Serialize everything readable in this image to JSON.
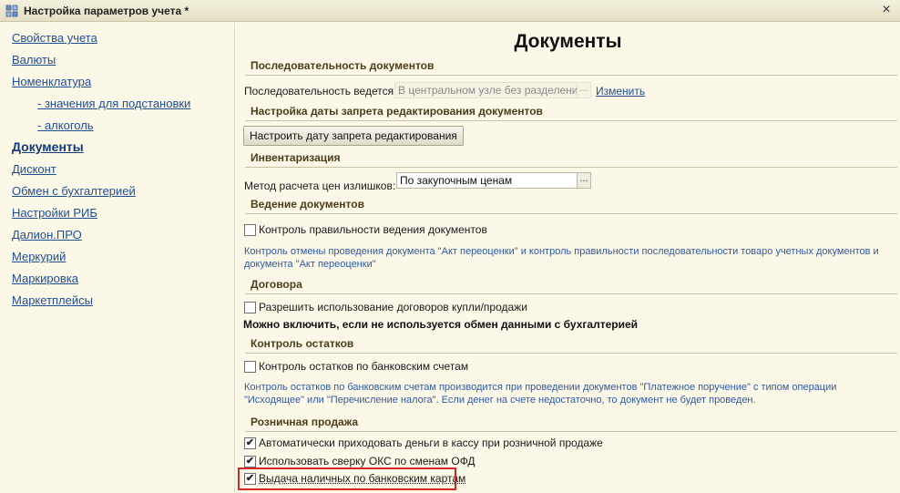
{
  "window": {
    "title": "Настройка параметров учета *",
    "close_icon": "close-icon"
  },
  "sidebar": {
    "items": [
      {
        "label": "Свойства учета"
      },
      {
        "label": "Валюты"
      },
      {
        "label": "Номенклатура"
      },
      {
        "label": "- значения для подстановки"
      },
      {
        "label": "- алкоголь"
      },
      {
        "label": "Документы",
        "active": true
      },
      {
        "label": "Дисконт"
      },
      {
        "label": "Обмен с бухгалтерией"
      },
      {
        "label": "Настройки РИБ"
      },
      {
        "label": "Далион.ПРО"
      },
      {
        "label": "Меркурий"
      },
      {
        "label": "Маркировка"
      },
      {
        "label": "Маркетплейсы"
      }
    ]
  },
  "main": {
    "title": "Документы",
    "sequence": {
      "header": "Последовательность документов",
      "label": "Последовательность ведется:",
      "value": "В центральном узле без разделения г",
      "dots": "...",
      "change_link": "Изменить"
    },
    "lock_date": {
      "header": "Настройка даты запрета редактирования документов",
      "button": "Настроить дату запрета редактирования"
    },
    "inventory": {
      "header": "Инвентаризация",
      "label": "Метод расчета цен излишков:",
      "value": "По закупочным ценам",
      "dots": "..."
    },
    "doc_keeping": {
      "header": "Ведение документов",
      "checkbox_label": "Контроль правильности ведения документов",
      "checked": false,
      "note_line1": "Контроль отмены проведения документа \"Акт переоценки\" и контроль правильности последовательности товаро учетных документов и",
      "note_line2": "документа \"Акт переоценки\""
    },
    "contracts": {
      "header": "Договора",
      "checkbox_label": "Разрешить использование договоров купли/продажи",
      "checked": false,
      "note": "Можно включить, если не используется обмен данными с бухгалтерией"
    },
    "balances": {
      "header": "Контроль остатков",
      "checkbox_label": "Контроль остатков по банковским счетам",
      "checked": false,
      "note_line1": "Контроль остатков по банковским счетам производится при проведении документов \"Платежное поручение\" с типом операции",
      "note_line2": "\"Исходящее\" или \"Перечисление налога\". Если денег на счете недостаточно, то документ не будет проведен."
    },
    "retail": {
      "header": "Розничная продажа",
      "items": [
        {
          "label": "Автоматически приходовать деньги в кассу при розничной продаже",
          "checked": true,
          "mark": "✔"
        },
        {
          "label": "Использовать сверку ОКС по сменам ОФД",
          "checked": true,
          "mark": "✔"
        },
        {
          "label": "Выдача наличных по банковским картам",
          "checked": true,
          "mark": "✔",
          "highlighted": true
        }
      ]
    }
  },
  "colors": {
    "background": "#fbf8e8",
    "link": "#1f4e96",
    "note": "#2e5aa6",
    "highlight": "#d42828"
  }
}
